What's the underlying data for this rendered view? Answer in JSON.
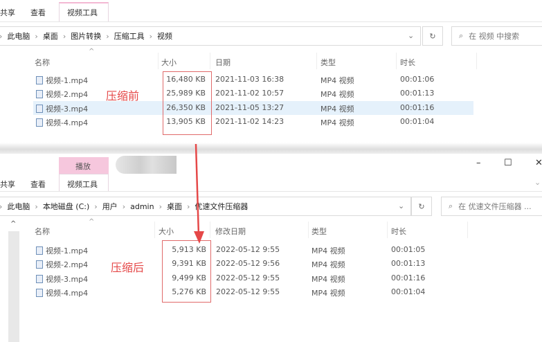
{
  "before": {
    "ribbon_tabs": [
      "共享",
      "查看",
      "视频工具"
    ],
    "breadcrumb": [
      "此电脑",
      "桌面",
      "图片转换",
      "压缩工具",
      "视频"
    ],
    "search_placeholder": "在 视频 中搜索",
    "columns": [
      "名称",
      "大小",
      "日期",
      "类型",
      "时长"
    ],
    "label": "压缩前",
    "rows": [
      {
        "name": "视频-1.mp4",
        "size": "16,480 KB",
        "date": "2021-11-03 16:38",
        "type": "MP4 视频",
        "duration": "00:01:06"
      },
      {
        "name": "视频-2.mp4",
        "size": "25,989 KB",
        "date": "2021-11-02 10:57",
        "type": "MP4 视频",
        "duration": "00:01:13"
      },
      {
        "name": "视频-3.mp4",
        "size": "26,350 KB",
        "date": "2021-11-05 13:27",
        "type": "MP4 视频",
        "duration": "00:01:16"
      },
      {
        "name": "视频-4.mp4",
        "size": "13,905 KB",
        "date": "2021-11-02 14:23",
        "type": "MP4 视频",
        "duration": "00:01:04"
      }
    ]
  },
  "after": {
    "context_tab": "播放",
    "ribbon_tabs": [
      "共享",
      "查看",
      "视频工具"
    ],
    "breadcrumb": [
      "此电脑",
      "本地磁盘 (C:)",
      "用户",
      "admin",
      "桌面",
      "优速文件压缩器"
    ],
    "search_placeholder": "在 优速文件压缩器 ...",
    "columns": [
      "名称",
      "大小",
      "修改日期",
      "类型",
      "时长"
    ],
    "label": "压缩后",
    "rows": [
      {
        "name": "视频-1.mp4",
        "size": "5,913 KB",
        "date": "2022-05-12 9:55",
        "type": "MP4 视频",
        "duration": "00:01:05"
      },
      {
        "name": "视频-2.mp4",
        "size": "9,391 KB",
        "date": "2022-05-12 9:56",
        "type": "MP4 视频",
        "duration": "00:01:13"
      },
      {
        "name": "视频-3.mp4",
        "size": "9,499 KB",
        "date": "2022-05-12 9:55",
        "type": "MP4 视频",
        "duration": "00:01:16"
      },
      {
        "name": "视频-4.mp4",
        "size": "5,276 KB",
        "date": "2022-05-12 9:55",
        "type": "MP4 视频",
        "duration": "00:01:04"
      }
    ]
  },
  "window_controls": {
    "minimize": "–",
    "maximize": "☐",
    "close": "✕"
  },
  "colors": {
    "accent_red": "#e54848",
    "tab_pink": "#f6c7dd",
    "selection": "#e5f1fb"
  }
}
